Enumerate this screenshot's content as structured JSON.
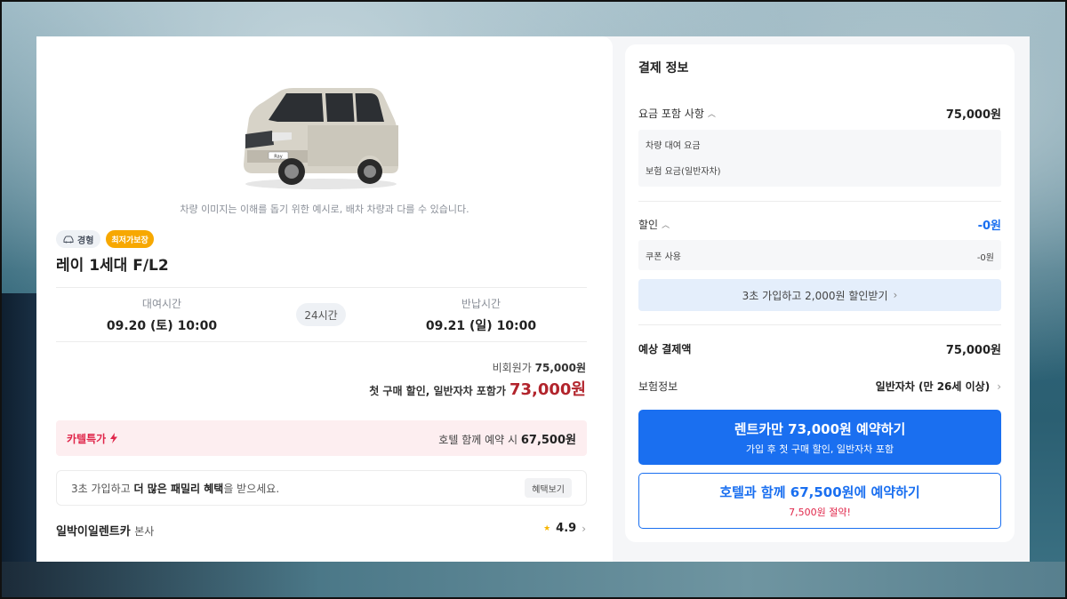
{
  "colors": {
    "accent": "#1a6ff0",
    "price_red": "#b2242c",
    "cartel_pink": "#e0264a",
    "badge_orange": "#f7a800"
  },
  "car": {
    "image_note": "차량 이미지는 이해를 돕기 위한 예시로, 배차 차량과 다를 수 있습니다.",
    "plate": "Ray",
    "type_badge": "경형",
    "lowest_badge": "최저가보장",
    "name": "레이 1세대 F/L2"
  },
  "rental": {
    "pickup_label": "대여시간",
    "pickup_value": "09.20 (토) 10:00",
    "duration": "24시간",
    "return_label": "반납시간",
    "return_value": "09.21 (일) 10:00"
  },
  "price": {
    "non_member_label": "비회원가",
    "non_member_value": "75,000원",
    "first_purchase_label": "첫 구매 할인, 일반자차 포함가",
    "first_purchase_value": "73,000원"
  },
  "cartel": {
    "label": "카텔특가",
    "hotel_text": "호텔 함께 예약 시",
    "hotel_value": "67,500원"
  },
  "family": {
    "text_pre": "3초 가입하고 ",
    "text_bold": "더 많은 패밀리 혜택",
    "text_post": "을 받으세요.",
    "button": "혜택보기"
  },
  "company": {
    "name": "일박이일렌트카",
    "branch": "본사",
    "rating": "4.9"
  },
  "payment": {
    "title": "결제 정보",
    "included_label": "요금 포함 사항",
    "included_value": "75,000원",
    "included_items": [
      "차량 대여 요금",
      "보험 요금(일반자차)"
    ],
    "discount_label": "할인",
    "discount_value": "-0원",
    "coupon_label": "쿠폰 사용",
    "coupon_value": "-0원",
    "promo_text": "3초 가입하고 2,000원 할인받기",
    "estimated_label": "예상 결제액",
    "estimated_value": "75,000원",
    "insurance_label": "보험정보",
    "insurance_value": "일반자차 (만 26세 이상)"
  },
  "cta": {
    "primary_main": "렌트카만 73,000원 예약하기",
    "primary_sub": "가입 후 첫 구매 할인, 일반자차 포함",
    "secondary_main": "호텔과 함께 67,500원에 예약하기",
    "secondary_sub": "7,500원 절약!"
  }
}
